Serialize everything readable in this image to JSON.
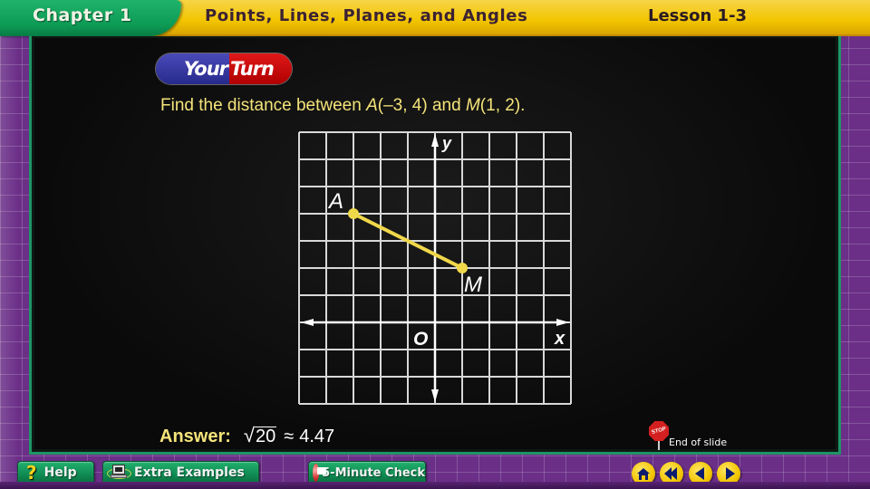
{
  "header": {
    "chapter": "Chapter 1",
    "lesson_title": "Points, Lines, Planes, and Angles",
    "lesson_number": "Lesson 1-3"
  },
  "badge": {
    "part1": "Your",
    "part2": "Turn"
  },
  "problem": {
    "prefix": "Find the distance between ",
    "point1_name": "A",
    "point1_coords": "(–3, 4)",
    "connector": " and ",
    "point2_name": "M",
    "point2_coords": "(1, 2)",
    "suffix": "."
  },
  "graph": {
    "x_range": [
      -5,
      5
    ],
    "y_range": [
      -3,
      7
    ],
    "x_axis_label": "x",
    "y_axis_label": "y",
    "origin_label": "O",
    "points": [
      {
        "name": "A",
        "x": -3,
        "y": 4
      },
      {
        "name": "M",
        "x": 1,
        "y": 2
      }
    ],
    "segment_color": "#f0d84a",
    "grid_color": "#d8d8d8"
  },
  "answer": {
    "label": "Answer:",
    "radical_symbol": "√",
    "radicand": "20",
    "approx_symbol": "≈",
    "decimal": "4.47"
  },
  "end_slide": {
    "stop_text": "STOP",
    "label": "End of slide"
  },
  "toolbar": {
    "help_label": "Help",
    "help_icon_glyph": "?",
    "extra_examples_label": "Extra Examples",
    "five_minute_check_label": "5-Minute Check"
  },
  "nav": {
    "home": "home-icon",
    "first": "rewind-icon",
    "previous": "previous-icon",
    "next": "next-icon"
  }
}
